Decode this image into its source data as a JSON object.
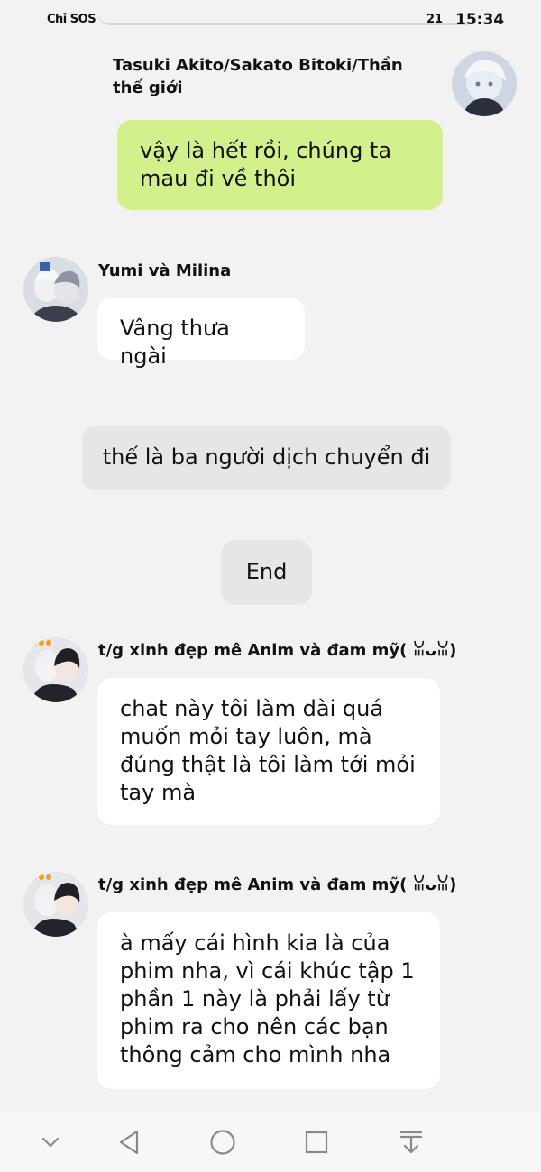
{
  "status_bar": {
    "carrier_text": "Chỉ SOS",
    "battery": "21",
    "time": "15:34"
  },
  "messages": [
    {
      "sender": "Tasuki Akito/Sakato Bitoki/Thần thế giới",
      "text": "vậy là hết rồi, chúng ta mau đi về thôi",
      "side": "right",
      "avatar_icon": "silver-hair-boy-avatar-icon"
    },
    {
      "sender": "Yumi và Milina",
      "text": "Vâng thưa ngài",
      "side": "left",
      "avatar_icon": "twin-girls-avatar-icon"
    },
    {
      "system_text": "thế là ba người dịch chuyển đi"
    },
    {
      "system_text": "End"
    },
    {
      "sender": "t/g xinh đẹp mê Anim và đam mỹ( ꈍᴗꈍ)",
      "text": "chat này tôi làm dài quá muốn mỏi tay luôn, mà đúng thật là tôi làm tới mỏi tay mà",
      "side": "left",
      "avatar_icon": "dark-hair-duo-avatar-icon"
    },
    {
      "sender": "t/g xinh đẹp mê Anim và đam mỹ( ꈍᴗꈍ)",
      "text": "à mấy cái hình kia là của phim nha, vì cái khúc tập 1 phần 1 này là phải lấy từ phim ra cho nên các bạn thông cảm cho mình nha",
      "side": "left",
      "avatar_icon": "dark-hair-duo-avatar-icon"
    }
  ],
  "nav_bar": {
    "icons": [
      "chevron-down-icon",
      "back-triangle-icon",
      "home-circle-icon",
      "recents-square-icon",
      "notification-pull-icon"
    ]
  },
  "colors": {
    "background": "#f2f2f3",
    "self_bubble": "#d3f08c",
    "other_bubble": "#ffffff",
    "system_bubble": "#e6e6e8"
  }
}
